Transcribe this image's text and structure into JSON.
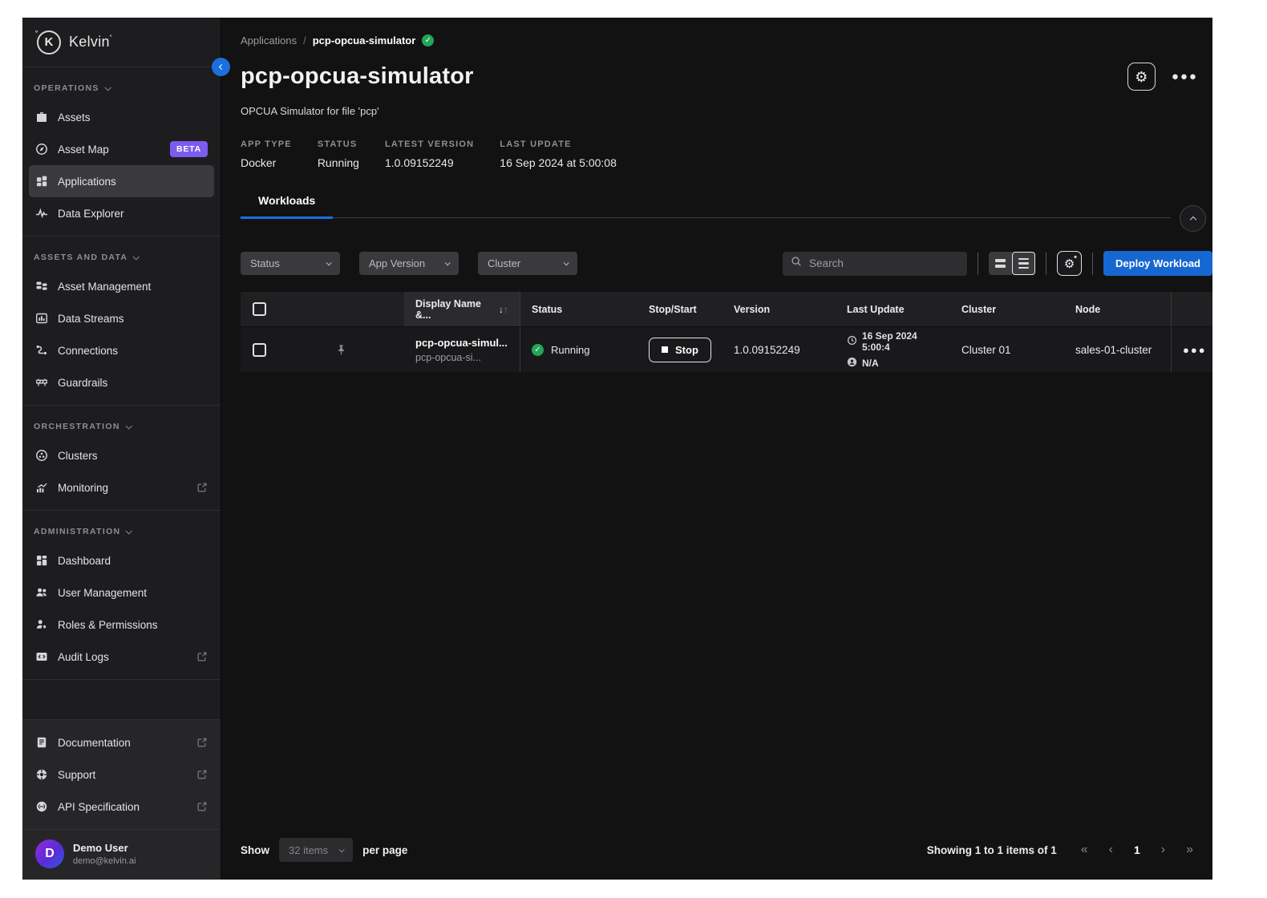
{
  "colors": {
    "accent_blue": "#1b6fe0",
    "success_green": "#23a55a",
    "beta_purple": "#7d5bf0",
    "deploy_blue": "#1767d2"
  },
  "brand": {
    "name": "Kelvin",
    "logo_letter": "K"
  },
  "sidebar": {
    "sections": [
      {
        "label": "OPERATIONS",
        "items": [
          {
            "label": "Assets"
          },
          {
            "label": "Asset Map",
            "badge": "BETA"
          },
          {
            "label": "Applications"
          },
          {
            "label": "Data Explorer"
          }
        ]
      },
      {
        "label": "ASSETS AND DATA",
        "items": [
          {
            "label": "Asset Management"
          },
          {
            "label": "Data Streams"
          },
          {
            "label": "Connections"
          },
          {
            "label": "Guardrails"
          }
        ]
      },
      {
        "label": "ORCHESTRATION",
        "items": [
          {
            "label": "Clusters"
          },
          {
            "label": "Monitoring"
          }
        ]
      },
      {
        "label": "ADMINISTRATION",
        "items": [
          {
            "label": "Dashboard"
          },
          {
            "label": "User Management"
          },
          {
            "label": "Roles & Permissions"
          },
          {
            "label": "Audit Logs"
          }
        ]
      }
    ],
    "footer_links": [
      {
        "label": "Documentation"
      },
      {
        "label": "Support"
      },
      {
        "label": "API Specification"
      }
    ],
    "user": {
      "initial": "D",
      "name": "Demo User",
      "email": "demo@kelvin.ai"
    }
  },
  "breadcrumb": {
    "parent": "Applications",
    "separator": "/",
    "current": "pcp-opcua-simulator",
    "check": "✓"
  },
  "header": {
    "title": "pcp-opcua-simulator",
    "description": "OPCUA Simulator for file 'pcp'",
    "meta": [
      {
        "label": "APP TYPE",
        "value": "Docker"
      },
      {
        "label": "STATUS",
        "value": "Running"
      },
      {
        "label": "LATEST VERSION",
        "value": "1.0.09152249"
      },
      {
        "label": "LAST UPDATE",
        "value": "16 Sep 2024 at 5:00:08"
      }
    ]
  },
  "tabs": {
    "workloads": "Workloads"
  },
  "toolbar": {
    "filters": [
      {
        "label": "Status"
      },
      {
        "label": "App Version"
      },
      {
        "label": "Cluster"
      }
    ],
    "search_placeholder": "Search",
    "deploy_label": "Deploy Workload"
  },
  "table": {
    "columns": {
      "display_name": "Display Name &...",
      "status": "Status",
      "stop_start": "Stop/Start",
      "version": "Version",
      "last_update": "Last Update",
      "cluster": "Cluster",
      "node": "Node"
    },
    "row": {
      "display_name": "pcp-opcua-simul...",
      "display_sub": "pcp-opcua-si...",
      "status": "Running",
      "status_check": "✓",
      "stop_label": "Stop",
      "version": "1.0.09152249",
      "last_update_time": "16 Sep 2024 5:00:4",
      "last_update_user": "N/A",
      "cluster": "Cluster 01",
      "node": "sales-01-cluster"
    }
  },
  "footer": {
    "show_label": "Show",
    "page_size": "32 items",
    "per_page_label": "per page",
    "summary": "Showing 1 to 1 items of 1",
    "current_page": "1"
  }
}
